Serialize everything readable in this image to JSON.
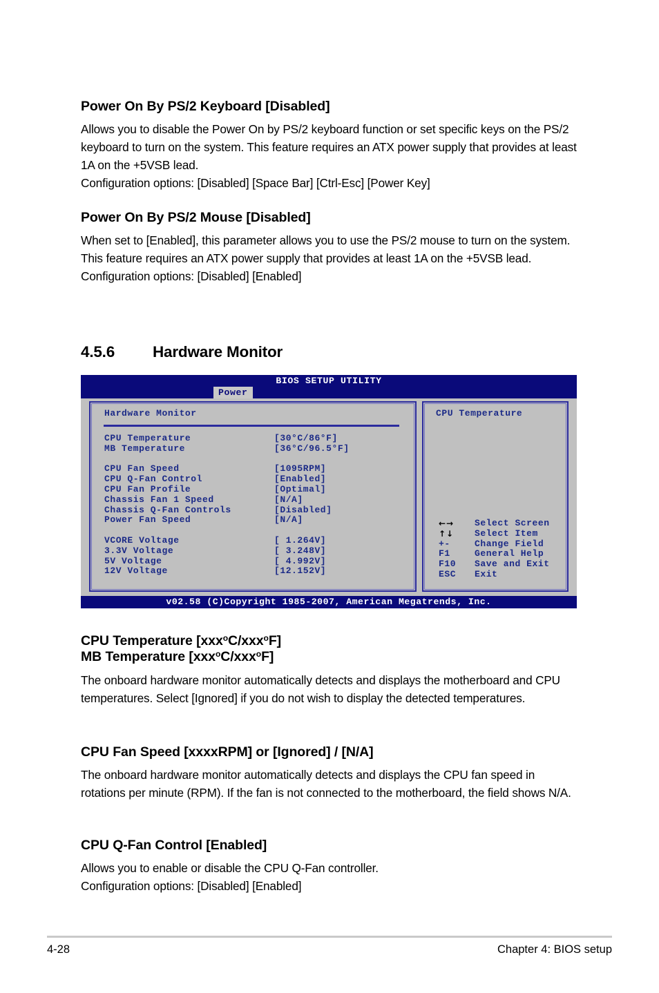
{
  "sections": [
    {
      "heading": "Power On By PS/2 Keyboard [Disabled]",
      "body": "Allows you to disable the Power On by PS/2 keyboard function or set specific keys on the PS/2 keyboard to turn on the system. This feature requires an ATX power supply that provides at least 1A on the +5VSB lead.\nConfiguration options: [Disabled] [Space Bar] [Ctrl-Esc] [Power Key]"
    },
    {
      "heading": "Power On By PS/2 Mouse [Disabled]",
      "body": "When set to [Enabled], this parameter allows you to use the PS/2 mouse to turn on the system. This feature requires an ATX power supply that provides at least 1A on the +5VSB lead. Configuration options: [Disabled] [Enabled]"
    },
    {
      "heading_line1": "CPU Temperature [xxx",
      "heading_line1b": "C/xxx",
      "heading_line1c": "F]",
      "heading_line2": "MB Temperature [xxx",
      "heading_line2b": "C/xxx",
      "heading_line2c": "F]",
      "deg": "o",
      "body": "The onboard hardware monitor automatically detects and displays the motherboard and CPU temperatures. Select [Ignored] if you do not wish to display the detected temperatures."
    },
    {
      "heading": "CPU Fan Speed [xxxxRPM] or [Ignored] / [N/A]",
      "body": "The onboard hardware monitor automatically detects and displays the CPU fan speed in rotations per minute (RPM). If the fan is not connected to the motherboard, the field shows N/A."
    },
    {
      "heading": "CPU Q-Fan Control [Enabled]",
      "body": "Allows you to enable or disable the CPU Q-Fan controller.\nConfiguration options: [Disabled] [Enabled]"
    }
  ],
  "section_number": {
    "number": "4.5.6",
    "title": "Hardware Monitor"
  },
  "bios": {
    "title": "BIOS SETUP UTILITY",
    "tab": "Power",
    "panel_title": "Hardware Monitor",
    "settings": [
      {
        "label": "CPU Temperature",
        "value": "[30°C/86°F]"
      },
      {
        "label": "MB Temperature",
        "value": "[36°C/96.5°F]"
      },
      {
        "label": "",
        "value": ""
      },
      {
        "label": "CPU Fan Speed",
        "value": "[1095RPM]"
      },
      {
        "label": "CPU Q-Fan Control",
        "value": "[Enabled]"
      },
      {
        "label": "CPU Fan Profile",
        "value": "[Optimal]"
      },
      {
        "label": "Chassis Fan 1 Speed",
        "value": "[N/A]"
      },
      {
        "label": "Chassis Q-Fan Controls",
        "value": "[Disabled]"
      },
      {
        "label": "Power Fan Speed",
        "value": "[N/A]"
      },
      {
        "label": "",
        "value": ""
      },
      {
        "label": "VCORE Voltage",
        "value": "[ 1.264V]"
      },
      {
        "label": "3.3V Voltage",
        "value": "[ 3.248V]"
      },
      {
        "label": "5V Voltage",
        "value": "[ 4.992V]"
      },
      {
        "label": "12V Voltage",
        "value": "[12.152V]"
      }
    ],
    "help_title": "CPU Temperature",
    "legend": [
      {
        "key": "←→",
        "desc": "Select Screen",
        "icon": "left-right-arrow-icon",
        "glyph": true
      },
      {
        "key": "↑↓",
        "desc": "Select Item",
        "icon": "up-down-arrow-icon",
        "glyph": true
      },
      {
        "key": "+-",
        "desc": "Change Field",
        "icon": "plus-minus-key",
        "glyph": false
      },
      {
        "key": "F1",
        "desc": "General Help",
        "icon": "f1-key",
        "glyph": false
      },
      {
        "key": "F10",
        "desc": "Save and Exit",
        "icon": "f10-key",
        "glyph": false
      },
      {
        "key": "ESC",
        "desc": "Exit",
        "icon": "esc-key",
        "glyph": false
      }
    ],
    "footer": "v02.58 (C)Copyright 1985-2007, American Megatrends, Inc.",
    "colors": {
      "titlebar_bg": "#0a0a7a",
      "panel_bg": "#c0c0c0",
      "text_blue": "#1b2a87",
      "border_blue": "#2b2b9e"
    }
  },
  "page_footer": {
    "page_number": "4-28",
    "chapter": "Chapter 4: BIOS setup"
  }
}
